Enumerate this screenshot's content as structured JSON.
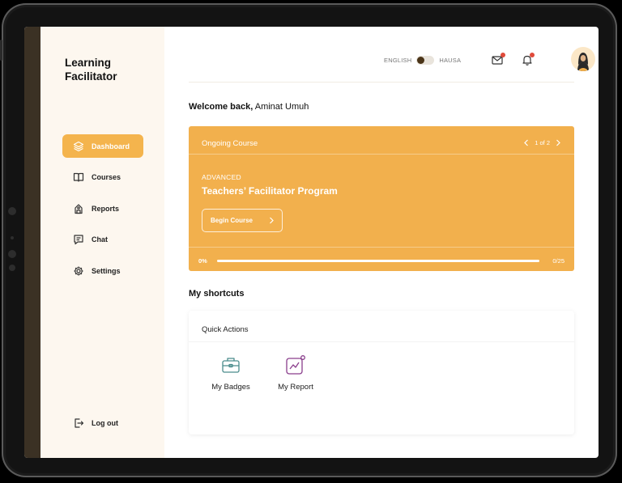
{
  "sidebar": {
    "brand_line1": "Learning",
    "brand_line2": "Facilitator",
    "items": [
      {
        "label": "Dashboard",
        "icon": "layers-icon",
        "active": true
      },
      {
        "label": "Courses",
        "icon": "book-icon"
      },
      {
        "label": "Reports",
        "icon": "report-icon"
      },
      {
        "label": "Chat",
        "icon": "chat-icon"
      },
      {
        "label": "Settings",
        "icon": "gear-icon"
      }
    ],
    "logout_label": "Log out"
  },
  "header": {
    "lang_left": "ENGLISH",
    "lang_right": "HAUSA",
    "notifications": true
  },
  "welcome": {
    "prefix": "Welcome back,",
    "name": "Aminat Umuh"
  },
  "course": {
    "section_label": "Ongoing Course",
    "pager": "1 of 2",
    "level": "ADVANCED",
    "title": "Teachers’ Facilitator Program",
    "button_label": "Begin Course",
    "progress_label": "0%",
    "progress_fraction": 0,
    "count_label": "0/25"
  },
  "shortcuts": {
    "title": "My shortcuts",
    "card_label": "Quick Actions",
    "items": [
      {
        "label": "My Badges",
        "icon": "briefcase-icon"
      },
      {
        "label": "My Report",
        "icon": "chart-icon"
      }
    ]
  },
  "colors": {
    "accent": "#f2b04d",
    "sidebar_bg": "#fdf7ef",
    "notification_dot": "#e04a3a",
    "badges_icon": "#4a8c8c",
    "report_icon": "#8a3e8c"
  }
}
